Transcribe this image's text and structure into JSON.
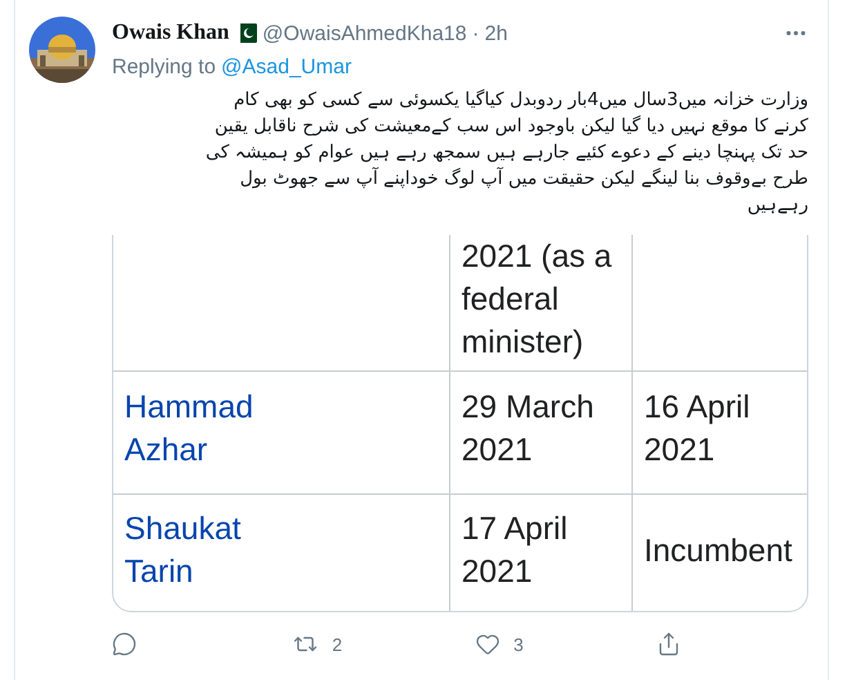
{
  "tweet": {
    "display_name": "Owais Khan",
    "handle": "@OwaisAhmedKha18",
    "separator": "·",
    "time": "2h",
    "replying_label": "Replying to",
    "replying_to": "@Asad_Umar",
    "text": "وزارت خزانہ میں3سال میں4بار ردوبدل کیاگیا یکسوئی سے کسی کو بھی کام کرنے کا موقع نہیں دیا گیا لیکن باوجود اس سب کےمعیشت کی شرح ناقابل یقین حد تک پہنچا دینے کے دعوے کئیے جارہے ہیں سمجھ رہے ہیں عوام کو ہمیشہ کی طرح بےوقوف بنا لینگے لیکن حقیقت میں آپ لوگ خوداپنے آپ سے جھوٹ بول رہےہیں",
    "table_rows": [
      {
        "cells": [
          {},
          {
            "text": "2021 (as a federal minister)"
          },
          {}
        ]
      },
      {
        "cells": [
          {
            "text": "Hammad Azhar",
            "kind": "link"
          },
          {
            "text": "29 March 2021"
          },
          {
            "text": "16 April 2021"
          }
        ]
      },
      {
        "cells": [
          {
            "text": "Shaukat Tarin",
            "kind": "link"
          },
          {
            "text": "17 April 2021"
          },
          {
            "text": "Incumbent"
          }
        ]
      }
    ],
    "actions": [
      {
        "kind": "reply"
      },
      {
        "kind": "retweet",
        "count": "2"
      },
      {
        "kind": "like",
        "count": "3"
      },
      {
        "kind": "share"
      }
    ]
  }
}
